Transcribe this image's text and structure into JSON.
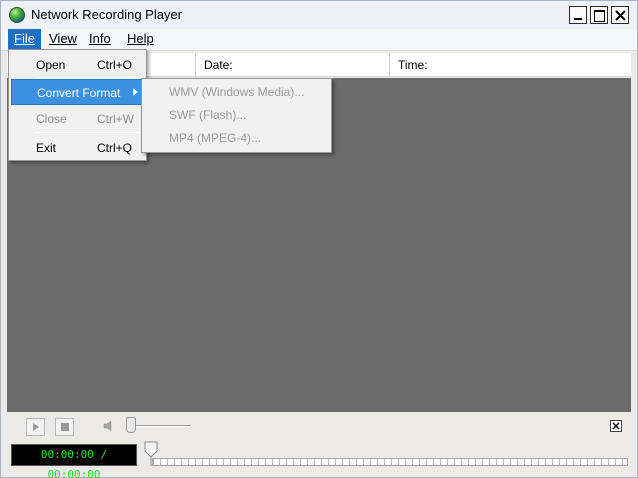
{
  "window": {
    "title": "Network Recording Player",
    "app_icon": "globe-app-icon",
    "controls": [
      "minimize-icon",
      "maximize-icon",
      "close-icon"
    ]
  },
  "menubar": {
    "file": "File",
    "view": "View",
    "info": "Info",
    "help": "Help"
  },
  "file_menu": {
    "items": [
      {
        "label": "Open",
        "shortcut": "Ctrl+O",
        "enabled": true
      },
      {
        "label": "Convert Format",
        "shortcut": "",
        "enabled": true,
        "highlighted": true,
        "submenu": true
      },
      {
        "label": "Close",
        "shortcut": "Ctrl+W",
        "enabled": false
      },
      {
        "label": "Exit",
        "shortcut": "Ctrl+Q",
        "enabled": true
      }
    ]
  },
  "convert_submenu": {
    "items": [
      {
        "label": "WMV (Windows Media)...",
        "enabled": false
      },
      {
        "label": "SWF (Flash)...",
        "enabled": false
      },
      {
        "label": "MP4 (MPEG-4)...",
        "enabled": false
      }
    ]
  },
  "columns": {
    "file": "",
    "date": "Date:",
    "time": "Time:"
  },
  "player": {
    "time_display": "00:00:00 / 00:00:00",
    "volume_level": 0.0,
    "seek_position": 0.0
  },
  "colors": {
    "accent": "#1c6fc6",
    "highlight": "#3d8fe0",
    "video_bg": "#6b6b6b",
    "time_text": "#26e02a"
  }
}
